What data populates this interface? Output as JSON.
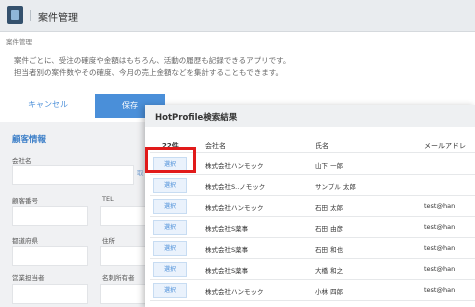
{
  "app": {
    "title": "案件管理"
  },
  "breadcrumb": "案件管理",
  "description": {
    "line1": "案件ごとに、受注の確度や金額はもちろん、活動の履歴も記録できるアプリです。",
    "line2": "担当者別の案件数やその確度、今月の売上金額などを集計することもできます。"
  },
  "buttons": {
    "cancel": "キャンセル",
    "save": "保存"
  },
  "form": {
    "section_title": "顧客情報",
    "labels": {
      "company": "会社名",
      "account_number": "顧客番号",
      "tel": "TEL",
      "prefecture": "都道府県",
      "address": "住所",
      "sales_rep": "営業担当者",
      "card_owner": "名刺所有者"
    },
    "side_link": "取"
  },
  "modal": {
    "title": "HotProfile検索結果",
    "columns": {
      "count": "22件",
      "company": "会社名",
      "name": "氏名",
      "email": "メールアドレ"
    },
    "select_label": "選択",
    "rows": [
      {
        "company": "株式会社ハンモック",
        "name": "山下 一郎",
        "email": ""
      },
      {
        "company": "株式会社S..ノモック",
        "name": "サンプル 太郎",
        "email": ""
      },
      {
        "company": "株式会社ハンモック",
        "name": "石田 太郎",
        "email": "test@han"
      },
      {
        "company": "株式会社S薬事",
        "name": "石田 由彦",
        "email": "test@han"
      },
      {
        "company": "株式会社S薬事",
        "name": "石田 和也",
        "email": "test@han"
      },
      {
        "company": "株式会社S薬事",
        "name": "大橋 和之",
        "email": "test@han"
      },
      {
        "company": "株式会社ハンモック",
        "name": "小林 四郎",
        "email": "test@han"
      }
    ]
  },
  "colors": {
    "accent": "#4a8fd9",
    "highlight": "#e11a1a",
    "section_title": "#3c7fc8"
  }
}
